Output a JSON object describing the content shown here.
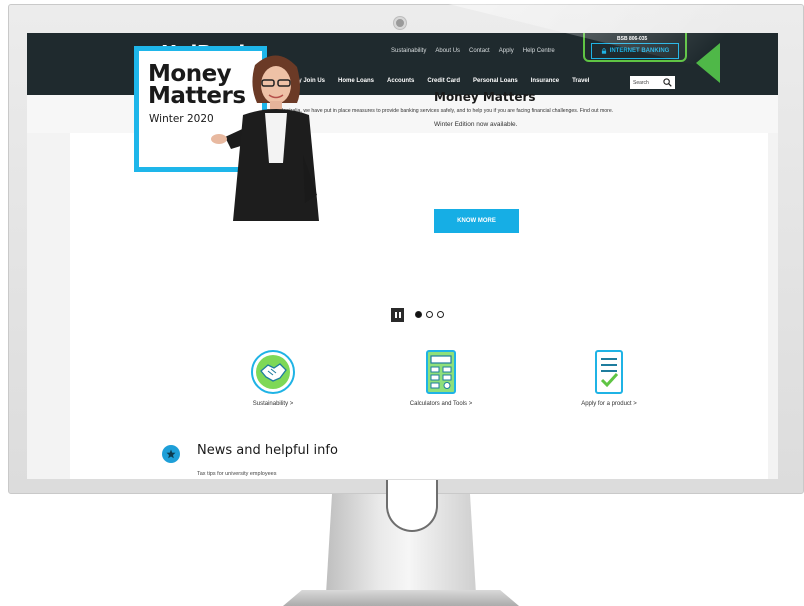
{
  "brand": {
    "logo_text": "UniBank",
    "accent_color": "#1eb6ea",
    "header_color": "#1f2a2e",
    "highlight_color": "#5fc444"
  },
  "header": {
    "bsb_text": "BSB 806-035",
    "utility_links": [
      "Sustainability",
      "About Us",
      "Contact",
      "Apply",
      "Help Centre"
    ],
    "internet_banking_label": "INTERNET BANKING",
    "main_nav": [
      "Why Join Us",
      "Home Loans",
      "Accounts",
      "Credit Card",
      "Personal Loans",
      "Insurance",
      "Travel"
    ],
    "search_label": "Search"
  },
  "alert": {
    "icon": "exclamation-icon",
    "text": "As the coronavirus continues to impact Australia, we have put in place measures to provide banking services safely, and to help you if you are facing financial challenges. Find out more."
  },
  "hero": {
    "box_title_line1": "Money",
    "box_title_line2": "Matters",
    "box_subtitle": "Winter 2020",
    "title": "Money Matters",
    "text": "Winter Edition now available.",
    "button_label": "KNOW MORE",
    "carousel": {
      "slides": 3,
      "active": 1
    }
  },
  "features": [
    {
      "label": "Sustainability >",
      "icon": "handshake-icon"
    },
    {
      "label": "Calculators and Tools >",
      "icon": "calculator-icon"
    },
    {
      "label": "Apply for a product >",
      "icon": "checklist-icon"
    }
  ],
  "news": {
    "title": "News and helpful info",
    "subtitle": "Tax tips for university employees",
    "icon": "star-icon"
  }
}
